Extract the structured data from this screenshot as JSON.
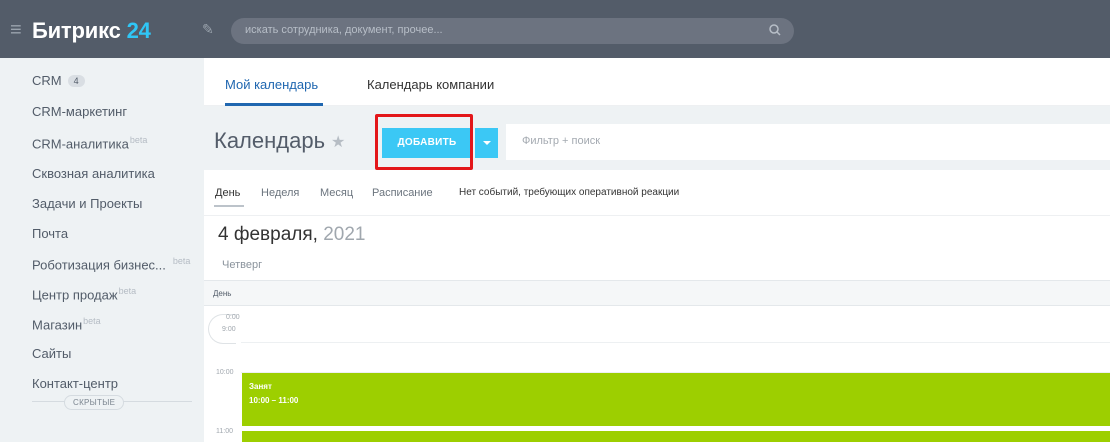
{
  "topbar": {
    "logo_main": "Битрикс",
    "logo_num": "24",
    "search_placeholder": "искать сотрудника, документ, прочее..."
  },
  "sidebar": {
    "items": [
      {
        "label": "CRM",
        "badge": "4"
      },
      {
        "label": "CRM-маркетинг"
      },
      {
        "label": "CRM-аналитика",
        "sup": "beta"
      },
      {
        "label": "Сквозная аналитика"
      },
      {
        "label": "Задачи и Проекты"
      },
      {
        "label": "Почта"
      },
      {
        "label": "Роботизация бизнес...",
        "sup": "beta"
      },
      {
        "label": "Центр продаж",
        "sup": "beta"
      },
      {
        "label": "Магазин",
        "sup": "beta"
      },
      {
        "label": "Сайты"
      },
      {
        "label": "Контакт-центр"
      }
    ],
    "hidden_label": "СКРЫТЫЕ"
  },
  "tabs": [
    {
      "label": "Мой календарь",
      "active": true
    },
    {
      "label": "Календарь компании",
      "active": false
    }
  ],
  "header": {
    "title": "Календарь",
    "add_button": "ДОБАВИТЬ",
    "filter_placeholder": "Фильтр + поиск"
  },
  "views": {
    "items": [
      "День",
      "Неделя",
      "Месяц",
      "Расписание"
    ],
    "active": "День",
    "note": "Нет событий, требующих оперативной реакции"
  },
  "date": {
    "day_month": "4 февраля,",
    "year": "2021",
    "weekday": "Четверг"
  },
  "day_view": {
    "header": "День",
    "times": [
      "0:00",
      "9:00",
      "10:00",
      "11:00"
    ],
    "event": {
      "title": "Занят",
      "range": "10:00 – 11:00"
    }
  },
  "colors": {
    "topbar": "#535c69",
    "accent": "#3bc8f5",
    "event": "#9dcf00",
    "tab_active": "#2067b0",
    "highlight": "#e3161a"
  }
}
